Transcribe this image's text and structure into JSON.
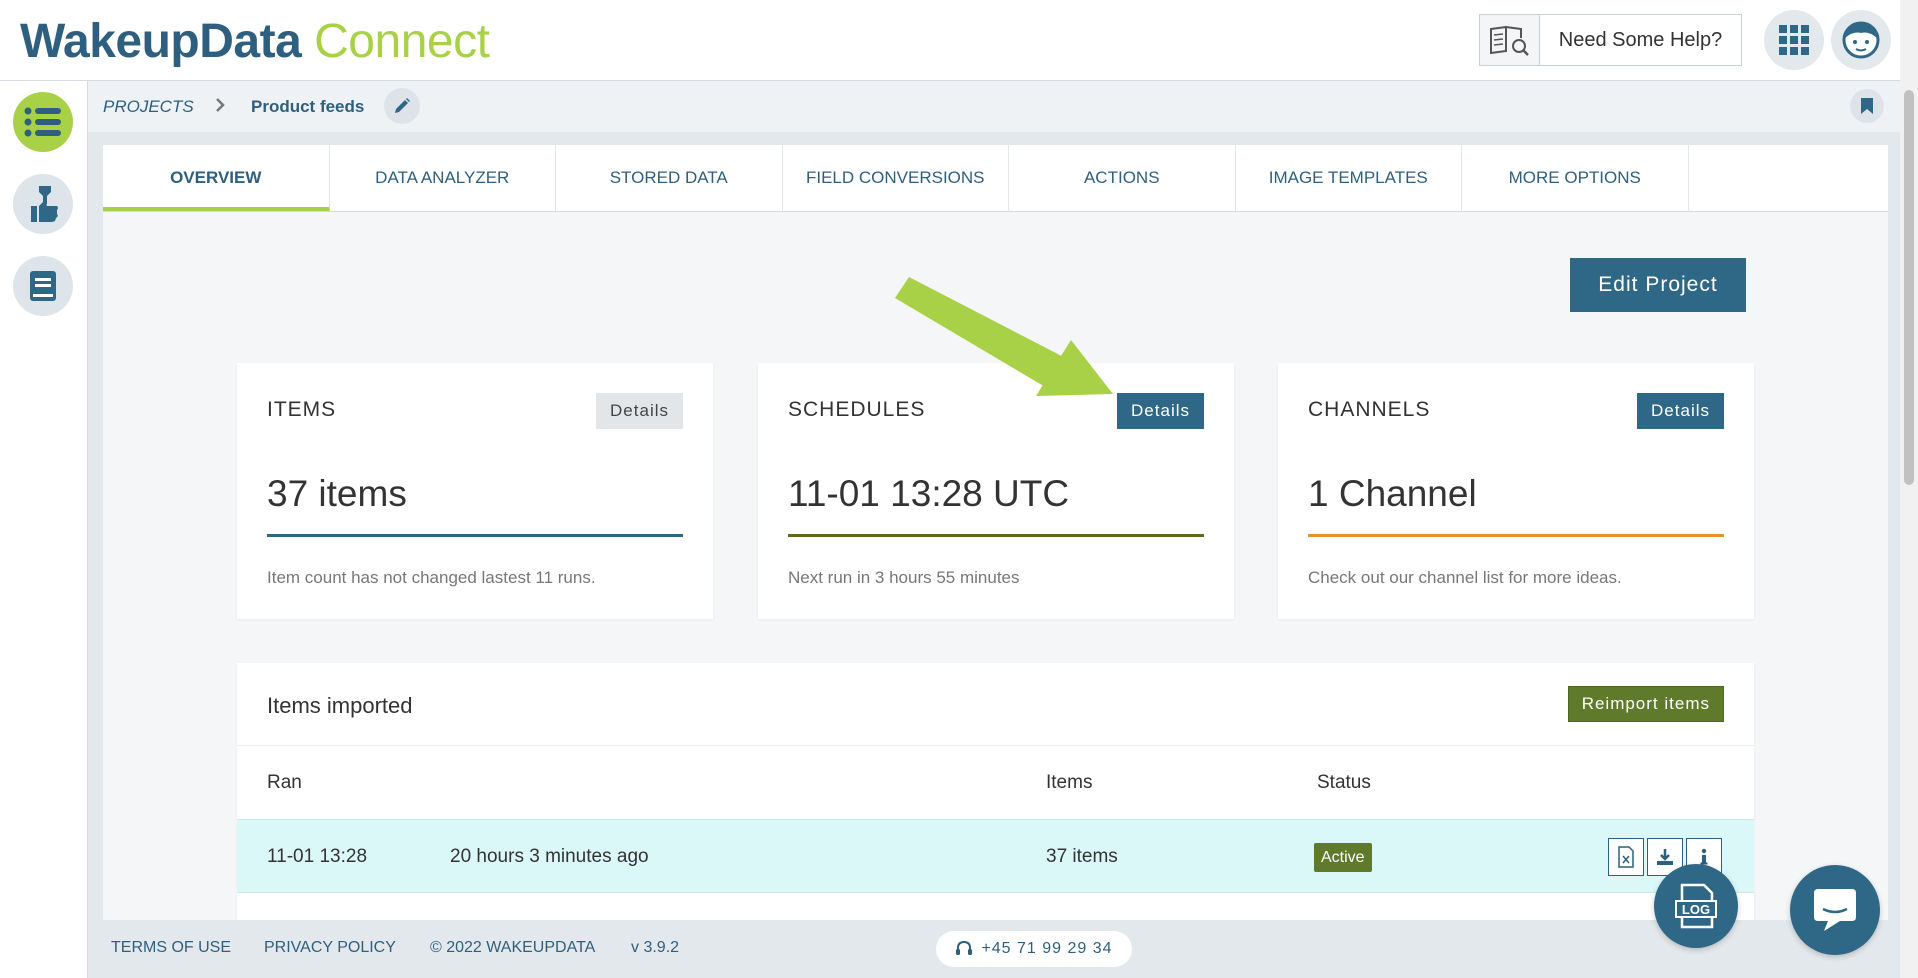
{
  "header": {
    "logo_part1": "WakeupData",
    "logo_part2": "Connect",
    "help_label": "Need Some Help?"
  },
  "breadcrumb": {
    "root": "PROJECTS",
    "current": "Product feeds"
  },
  "tabs": [
    {
      "label": "OVERVIEW",
      "active": true
    },
    {
      "label": "DATA ANALYZER"
    },
    {
      "label": "STORED DATA"
    },
    {
      "label": "FIELD CONVERSIONS"
    },
    {
      "label": "ACTIONS"
    },
    {
      "label": "IMAGE TEMPLATES"
    },
    {
      "label": "MORE OPTIONS"
    }
  ],
  "edit_project_label": "Edit Project",
  "cards": [
    {
      "title": "ITEMS",
      "details": "Details",
      "value": "37 items",
      "desc": "Item count has not changed lastest 11 runs.",
      "line_color": "#2f6887"
    },
    {
      "title": "SCHEDULES",
      "details": "Details",
      "value": "11-01 13:28 UTC",
      "desc": "Next run in 3 hours 55 minutes",
      "line_color": "#5e6a1e"
    },
    {
      "title": "CHANNELS",
      "details": "Details",
      "value": "1 Channel",
      "desc": "Check out our channel list for more ideas.",
      "line_color": "#e8922e"
    }
  ],
  "imported": {
    "title": "Items imported",
    "reimport_label": "Reimport items",
    "columns": {
      "ran": "Ran",
      "items": "Items",
      "status": "Status"
    },
    "rows": [
      {
        "date": "11-01 13:28",
        "ago": "20 hours 3 minutes ago",
        "items": "37 items",
        "status": "Active"
      }
    ]
  },
  "footer": {
    "terms": "TERMS OF USE",
    "privacy": "PRIVACY POLICY",
    "copyright": "© 2022 WAKEUPDATA",
    "version": "v 3.9.2",
    "phone": "+45 71 99 29 34"
  },
  "log_label": "LOG",
  "colors": {
    "brand_blue": "#2f6887",
    "brand_green": "#a8d147",
    "olive": "#5e7a2a"
  }
}
